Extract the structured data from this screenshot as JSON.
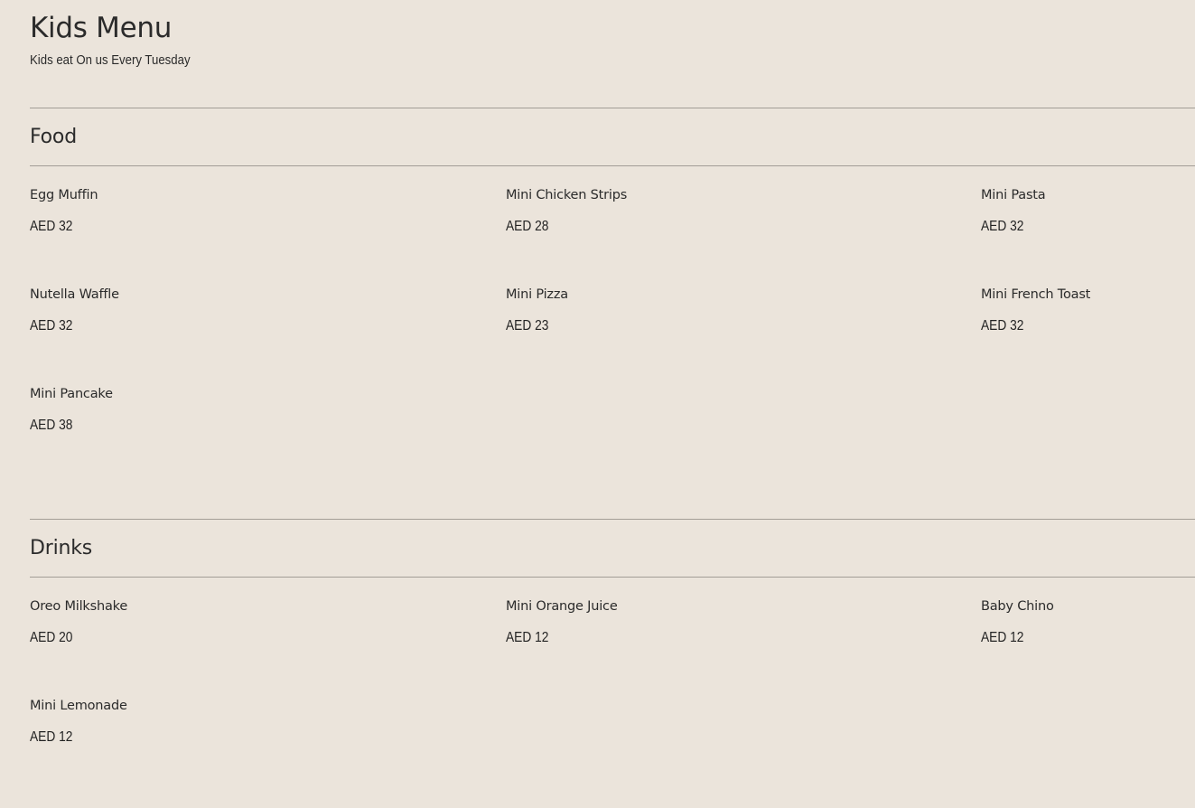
{
  "header": {
    "title": "Kids Menu",
    "subtitle": "Kids eat On us Every Tuesday"
  },
  "sections": [
    {
      "title": "Food",
      "items": [
        {
          "name": "Egg Muffin",
          "price": "AED 32"
        },
        {
          "name": "Mini Chicken Strips",
          "price": "AED 28"
        },
        {
          "name": "Mini Pasta",
          "price": "AED 32"
        },
        {
          "name": "Nutella Waffle",
          "price": "AED 32"
        },
        {
          "name": "Mini Pizza",
          "price": "AED 23"
        },
        {
          "name": "Mini French Toast",
          "price": "AED 32"
        },
        {
          "name": "Mini Pancake",
          "price": "AED 38"
        }
      ]
    },
    {
      "title": "Drinks",
      "items": [
        {
          "name": "Oreo Milkshake",
          "price": "AED 20"
        },
        {
          "name": "Mini Orange Juice",
          "price": "AED 12"
        },
        {
          "name": "Baby Chino",
          "price": "AED 12"
        },
        {
          "name": "Mini Lemonade",
          "price": "AED 12"
        }
      ]
    }
  ]
}
